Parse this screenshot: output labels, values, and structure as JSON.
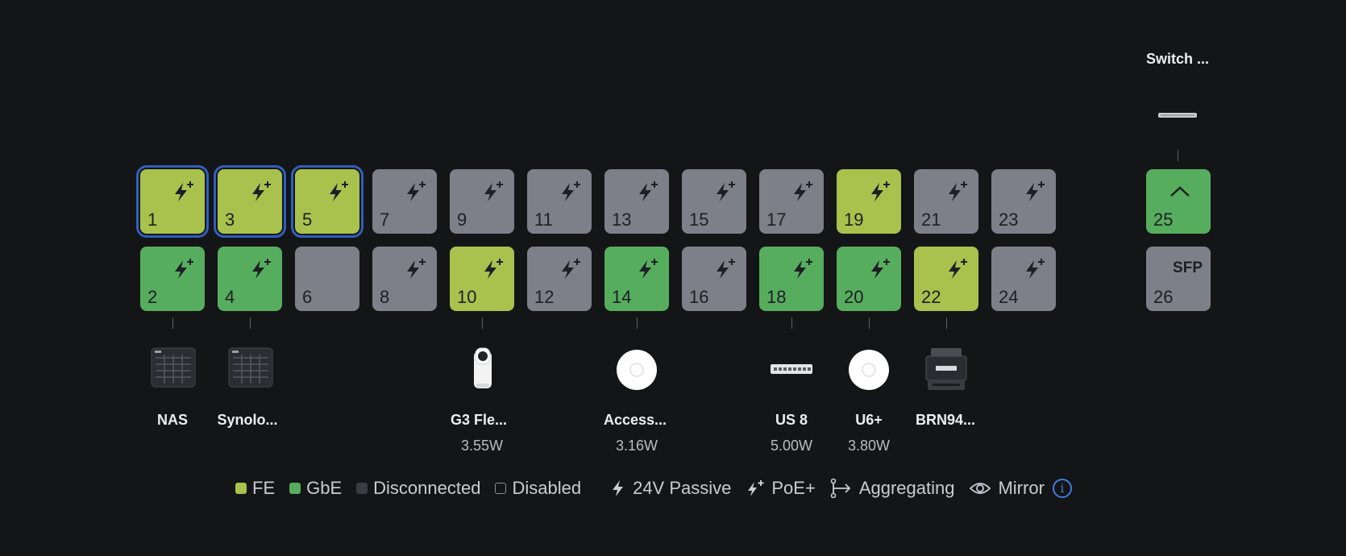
{
  "switch": {
    "name": "Switch ..."
  },
  "ports": [
    {
      "num": "1",
      "state": "fe",
      "poe": true,
      "selected": true
    },
    {
      "num": "3",
      "state": "fe",
      "poe": true,
      "selected": true
    },
    {
      "num": "5",
      "state": "fe",
      "poe": true,
      "selected": true
    },
    {
      "num": "7",
      "state": "off",
      "poe": true
    },
    {
      "num": "9",
      "state": "off",
      "poe": true
    },
    {
      "num": "11",
      "state": "off",
      "poe": true
    },
    {
      "num": "13",
      "state": "off",
      "poe": true
    },
    {
      "num": "15",
      "state": "off",
      "poe": true
    },
    {
      "num": "17",
      "state": "off",
      "poe": true
    },
    {
      "num": "19",
      "state": "fe",
      "poe": true
    },
    {
      "num": "21",
      "state": "off",
      "poe": true
    },
    {
      "num": "23",
      "state": "off",
      "poe": true
    },
    {
      "num": "2",
      "state": "gbe",
      "poe": true
    },
    {
      "num": "4",
      "state": "gbe",
      "poe": true
    },
    {
      "num": "6",
      "state": "off",
      "poe": false
    },
    {
      "num": "8",
      "state": "off",
      "poe": true
    },
    {
      "num": "10",
      "state": "fe",
      "poe": true
    },
    {
      "num": "12",
      "state": "off",
      "poe": true
    },
    {
      "num": "14",
      "state": "gbe",
      "poe": true
    },
    {
      "num": "16",
      "state": "off",
      "poe": true
    },
    {
      "num": "18",
      "state": "gbe",
      "poe": true
    },
    {
      "num": "20",
      "state": "gbe",
      "poe": true
    },
    {
      "num": "22",
      "state": "fe",
      "poe": true
    },
    {
      "num": "24",
      "state": "off",
      "poe": true
    }
  ],
  "uplink_ports": [
    {
      "num": "25",
      "state": "gbe",
      "uplink": true
    },
    {
      "num": "26",
      "state": "off",
      "sfp_label": "SFP"
    }
  ],
  "devices": [
    {
      "name": "NAS",
      "power": "",
      "icon": "nas-icon"
    },
    {
      "name": "Synolo...",
      "power": "",
      "icon": "nas-icon"
    },
    {
      "name": "G3 Fle...",
      "power": "3.55W",
      "icon": "camera-icon"
    },
    {
      "name": "Access...",
      "power": "3.16W",
      "icon": "access-point-icon"
    },
    {
      "name": "US 8",
      "power": "5.00W",
      "icon": "switch-icon"
    },
    {
      "name": "U6+",
      "power": "3.80W",
      "icon": "access-point-icon"
    },
    {
      "name": "BRN94...",
      "power": "",
      "icon": "printer-icon"
    }
  ],
  "legend": {
    "fe": "FE",
    "gbe": "GbE",
    "disconnected": "Disconnected",
    "disabled": "Disabled",
    "passive": "24V Passive",
    "poe_plus": "PoE+",
    "aggregating": "Aggregating",
    "mirror": "Mirror"
  },
  "colors": {
    "fe": "#a9c24e",
    "gbe": "#57ad5e",
    "disconnected": "#7e8089",
    "selected": "#2f5fbf",
    "info": "#3d7de0"
  }
}
